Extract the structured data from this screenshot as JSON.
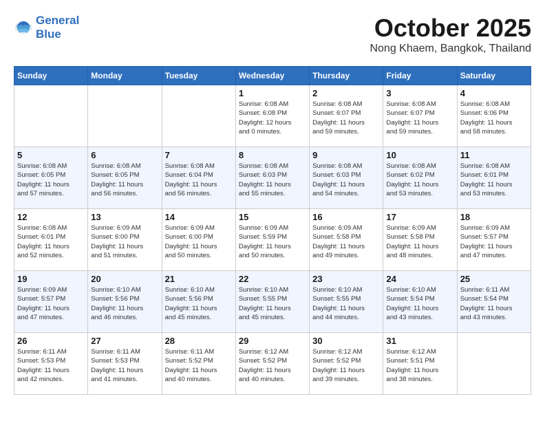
{
  "header": {
    "logo_line1": "General",
    "logo_line2": "Blue",
    "month": "October 2025",
    "location": "Nong Khaem, Bangkok, Thailand"
  },
  "weekdays": [
    "Sunday",
    "Monday",
    "Tuesday",
    "Wednesday",
    "Thursday",
    "Friday",
    "Saturday"
  ],
  "weeks": [
    [
      {
        "day": "",
        "info": ""
      },
      {
        "day": "",
        "info": ""
      },
      {
        "day": "",
        "info": ""
      },
      {
        "day": "1",
        "info": "Sunrise: 6:08 AM\nSunset: 6:08 PM\nDaylight: 12 hours\nand 0 minutes."
      },
      {
        "day": "2",
        "info": "Sunrise: 6:08 AM\nSunset: 6:07 PM\nDaylight: 11 hours\nand 59 minutes."
      },
      {
        "day": "3",
        "info": "Sunrise: 6:08 AM\nSunset: 6:07 PM\nDaylight: 11 hours\nand 59 minutes."
      },
      {
        "day": "4",
        "info": "Sunrise: 6:08 AM\nSunset: 6:06 PM\nDaylight: 11 hours\nand 58 minutes."
      }
    ],
    [
      {
        "day": "5",
        "info": "Sunrise: 6:08 AM\nSunset: 6:05 PM\nDaylight: 11 hours\nand 57 minutes."
      },
      {
        "day": "6",
        "info": "Sunrise: 6:08 AM\nSunset: 6:05 PM\nDaylight: 11 hours\nand 56 minutes."
      },
      {
        "day": "7",
        "info": "Sunrise: 6:08 AM\nSunset: 6:04 PM\nDaylight: 11 hours\nand 56 minutes."
      },
      {
        "day": "8",
        "info": "Sunrise: 6:08 AM\nSunset: 6:03 PM\nDaylight: 11 hours\nand 55 minutes."
      },
      {
        "day": "9",
        "info": "Sunrise: 6:08 AM\nSunset: 6:03 PM\nDaylight: 11 hours\nand 54 minutes."
      },
      {
        "day": "10",
        "info": "Sunrise: 6:08 AM\nSunset: 6:02 PM\nDaylight: 11 hours\nand 53 minutes."
      },
      {
        "day": "11",
        "info": "Sunrise: 6:08 AM\nSunset: 6:01 PM\nDaylight: 11 hours\nand 53 minutes."
      }
    ],
    [
      {
        "day": "12",
        "info": "Sunrise: 6:08 AM\nSunset: 6:01 PM\nDaylight: 11 hours\nand 52 minutes."
      },
      {
        "day": "13",
        "info": "Sunrise: 6:09 AM\nSunset: 6:00 PM\nDaylight: 11 hours\nand 51 minutes."
      },
      {
        "day": "14",
        "info": "Sunrise: 6:09 AM\nSunset: 6:00 PM\nDaylight: 11 hours\nand 50 minutes."
      },
      {
        "day": "15",
        "info": "Sunrise: 6:09 AM\nSunset: 5:59 PM\nDaylight: 11 hours\nand 50 minutes."
      },
      {
        "day": "16",
        "info": "Sunrise: 6:09 AM\nSunset: 5:58 PM\nDaylight: 11 hours\nand 49 minutes."
      },
      {
        "day": "17",
        "info": "Sunrise: 6:09 AM\nSunset: 5:58 PM\nDaylight: 11 hours\nand 48 minutes."
      },
      {
        "day": "18",
        "info": "Sunrise: 6:09 AM\nSunset: 5:57 PM\nDaylight: 11 hours\nand 47 minutes."
      }
    ],
    [
      {
        "day": "19",
        "info": "Sunrise: 6:09 AM\nSunset: 5:57 PM\nDaylight: 11 hours\nand 47 minutes."
      },
      {
        "day": "20",
        "info": "Sunrise: 6:10 AM\nSunset: 5:56 PM\nDaylight: 11 hours\nand 46 minutes."
      },
      {
        "day": "21",
        "info": "Sunrise: 6:10 AM\nSunset: 5:56 PM\nDaylight: 11 hours\nand 45 minutes."
      },
      {
        "day": "22",
        "info": "Sunrise: 6:10 AM\nSunset: 5:55 PM\nDaylight: 11 hours\nand 45 minutes."
      },
      {
        "day": "23",
        "info": "Sunrise: 6:10 AM\nSunset: 5:55 PM\nDaylight: 11 hours\nand 44 minutes."
      },
      {
        "day": "24",
        "info": "Sunrise: 6:10 AM\nSunset: 5:54 PM\nDaylight: 11 hours\nand 43 minutes."
      },
      {
        "day": "25",
        "info": "Sunrise: 6:11 AM\nSunset: 5:54 PM\nDaylight: 11 hours\nand 43 minutes."
      }
    ],
    [
      {
        "day": "26",
        "info": "Sunrise: 6:11 AM\nSunset: 5:53 PM\nDaylight: 11 hours\nand 42 minutes."
      },
      {
        "day": "27",
        "info": "Sunrise: 6:11 AM\nSunset: 5:53 PM\nDaylight: 11 hours\nand 41 minutes."
      },
      {
        "day": "28",
        "info": "Sunrise: 6:11 AM\nSunset: 5:52 PM\nDaylight: 11 hours\nand 40 minutes."
      },
      {
        "day": "29",
        "info": "Sunrise: 6:12 AM\nSunset: 5:52 PM\nDaylight: 11 hours\nand 40 minutes."
      },
      {
        "day": "30",
        "info": "Sunrise: 6:12 AM\nSunset: 5:52 PM\nDaylight: 11 hours\nand 39 minutes."
      },
      {
        "day": "31",
        "info": "Sunrise: 6:12 AM\nSunset: 5:51 PM\nDaylight: 11 hours\nand 38 minutes."
      },
      {
        "day": "",
        "info": ""
      }
    ]
  ]
}
